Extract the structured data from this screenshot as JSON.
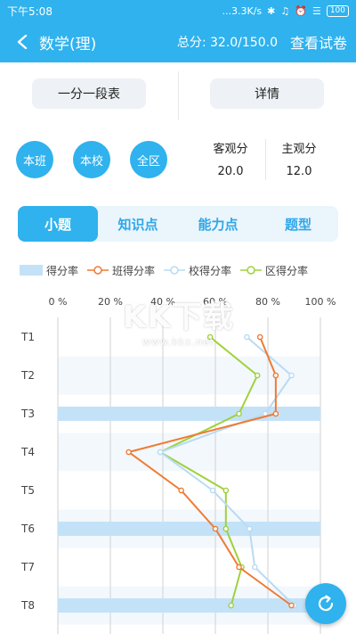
{
  "status_bar": {
    "time": "下午5:08",
    "speed": "...3.3K/s",
    "battery": "100"
  },
  "app_bar": {
    "title": "数学(理)",
    "total_label": "总分: 32.0/150.0",
    "view_paper": "查看试卷"
  },
  "top_buttons": {
    "score_table": "一分一段表",
    "details": "详情"
  },
  "scopes": [
    "本班",
    "本校",
    "全区"
  ],
  "scores": {
    "objective_label": "客观分",
    "objective_value": "20.0",
    "subjective_label": "主观分",
    "subjective_value": "12.0"
  },
  "tabs": [
    "小题",
    "知识点",
    "能力点",
    "题型"
  ],
  "active_tab": 0,
  "legend": [
    "得分率",
    "班得分率",
    "校得分率",
    "区得分率"
  ],
  "colors": {
    "primary": "#2fb2ee",
    "bar": "#c3e2f8",
    "class": "#f07a33",
    "school": "#b9dbf3",
    "district": "#9fd13b"
  },
  "watermark": {
    "logo": "KK下载",
    "url": "www.kkx.net"
  },
  "chart_data": {
    "type": "bar",
    "orientation": "horizontal",
    "categories": [
      "T1",
      "T2",
      "T3",
      "T4",
      "T5",
      "T6",
      "T7",
      "T8"
    ],
    "xlim": [
      0,
      100
    ],
    "xticks": [
      "0 %",
      "20 %",
      "40 %",
      "60 %",
      "80 %",
      "100 %"
    ],
    "series": [
      {
        "name": "得分率",
        "kind": "bar",
        "values": [
          0,
          0,
          100,
          0,
          0,
          100,
          0,
          100
        ]
      },
      {
        "name": "班得分率",
        "kind": "line",
        "values": [
          77,
          83,
          83,
          27,
          47,
          60,
          69,
          89
        ]
      },
      {
        "name": "校得分率",
        "kind": "line",
        "values": [
          72,
          89,
          79,
          39,
          59,
          73,
          75,
          90
        ]
      },
      {
        "name": "区得分率",
        "kind": "line",
        "values": [
          58,
          76,
          69,
          39,
          64,
          64,
          70,
          66
        ]
      }
    ]
  }
}
